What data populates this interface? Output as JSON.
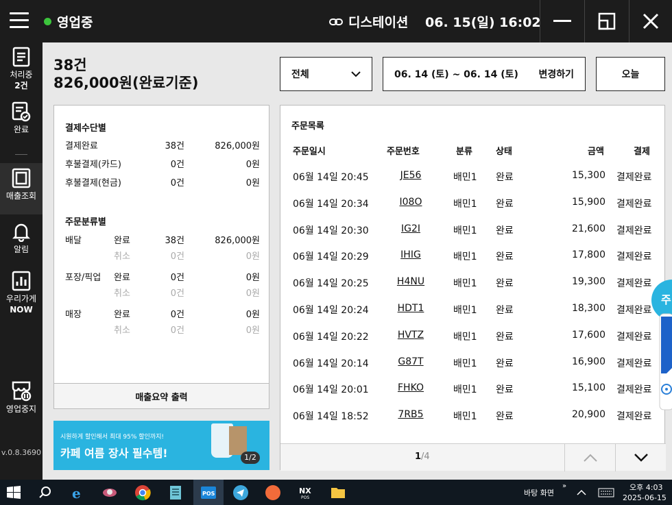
{
  "topbar": {
    "status": "영업중",
    "store": "디스테이션",
    "datetime": "06. 15(일) 16:02"
  },
  "sidebar": {
    "items": [
      {
        "label": "처리중",
        "sub": "2건",
        "icon": "clipboard-icon"
      },
      {
        "label": "완료",
        "icon": "check-document-icon"
      },
      {
        "label": "매출조회",
        "icon": "ledger-icon"
      },
      {
        "label": "알림",
        "icon": "bell-icon"
      },
      {
        "label": "우리가게",
        "sub": "NOW",
        "icon": "bar-chart-icon"
      },
      {
        "label": "영업중지",
        "icon": "store-pause-icon"
      }
    ],
    "version": "v.0.8.3690"
  },
  "summary": {
    "count": "38건",
    "amount": "826,000원(완료기준)"
  },
  "filter": {
    "selected": "전체",
    "date_range": "06. 14 (토) ~ 06. 14 (토)",
    "change_label": "변경하기",
    "today_label": "오늘"
  },
  "payment": {
    "title": "결제수단별",
    "rows": [
      {
        "label": "결제완료",
        "count": "38건",
        "amount": "826,000원"
      },
      {
        "label": "후불결제(카드)",
        "count": "0건",
        "amount": "0원"
      },
      {
        "label": "후불결제(현금)",
        "count": "0건",
        "amount": "0원"
      }
    ]
  },
  "category": {
    "title": "주문분류별",
    "groups": [
      {
        "name": "배달",
        "done": {
          "label": "완료",
          "count": "38건",
          "amount": "826,000원"
        },
        "cancel": {
          "label": "취소",
          "count": "0건",
          "amount": "0원"
        }
      },
      {
        "name": "포장/픽업",
        "done": {
          "label": "완료",
          "count": "0건",
          "amount": "0원"
        },
        "cancel": {
          "label": "취소",
          "count": "0건",
          "amount": "0원"
        }
      },
      {
        "name": "매장",
        "done": {
          "label": "완료",
          "count": "0건",
          "amount": "0원"
        },
        "cancel": {
          "label": "취소",
          "count": "0건",
          "amount": "0원"
        }
      }
    ]
  },
  "print_label": "매출요약 출력",
  "banner": {
    "small": "시원하게 할인해서 최대 95% 할인까지!",
    "big": "카페 여름 장사 필수템!",
    "page": "1/2"
  },
  "orders": {
    "title": "주문목록",
    "headers": [
      "주문일시",
      "주문번호",
      "분류",
      "상태",
      "금액",
      "결제"
    ],
    "rows": [
      [
        "06월 14일 20:45",
        "JE56",
        "배민1",
        "완료",
        "15,300",
        "결제완료"
      ],
      [
        "06월 14일 20:34",
        "I08O",
        "배민1",
        "완료",
        "15,900",
        "결제완료"
      ],
      [
        "06월 14일 20:30",
        "IG2I",
        "배민1",
        "완료",
        "21,600",
        "결제완료"
      ],
      [
        "06월 14일 20:29",
        "IHIG",
        "배민1",
        "완료",
        "17,800",
        "결제완료"
      ],
      [
        "06월 14일 20:25",
        "H4NU",
        "배민1",
        "완료",
        "19,300",
        "결제완료"
      ],
      [
        "06월 14일 20:24",
        "HDT1",
        "배민1",
        "완료",
        "18,300",
        "결제완료"
      ],
      [
        "06월 14일 20:22",
        "HVTZ",
        "배민1",
        "완료",
        "17,600",
        "결제완료"
      ],
      [
        "06월 14일 20:14",
        "G87T",
        "배민1",
        "완료",
        "16,900",
        "결제완료"
      ],
      [
        "06월 14일 20:01",
        "FHKO",
        "배민1",
        "완료",
        "15,100",
        "결제완료"
      ],
      [
        "06월 14일 18:52",
        "7RB5",
        "배민1",
        "완료",
        "20,900",
        "결제완료"
      ]
    ],
    "page": "1",
    "page_total": "/4"
  },
  "edge_label": "주",
  "taskbar": {
    "desktop": "바탕 화면",
    "time": "오후 4:03",
    "date": "2025-06-15"
  }
}
